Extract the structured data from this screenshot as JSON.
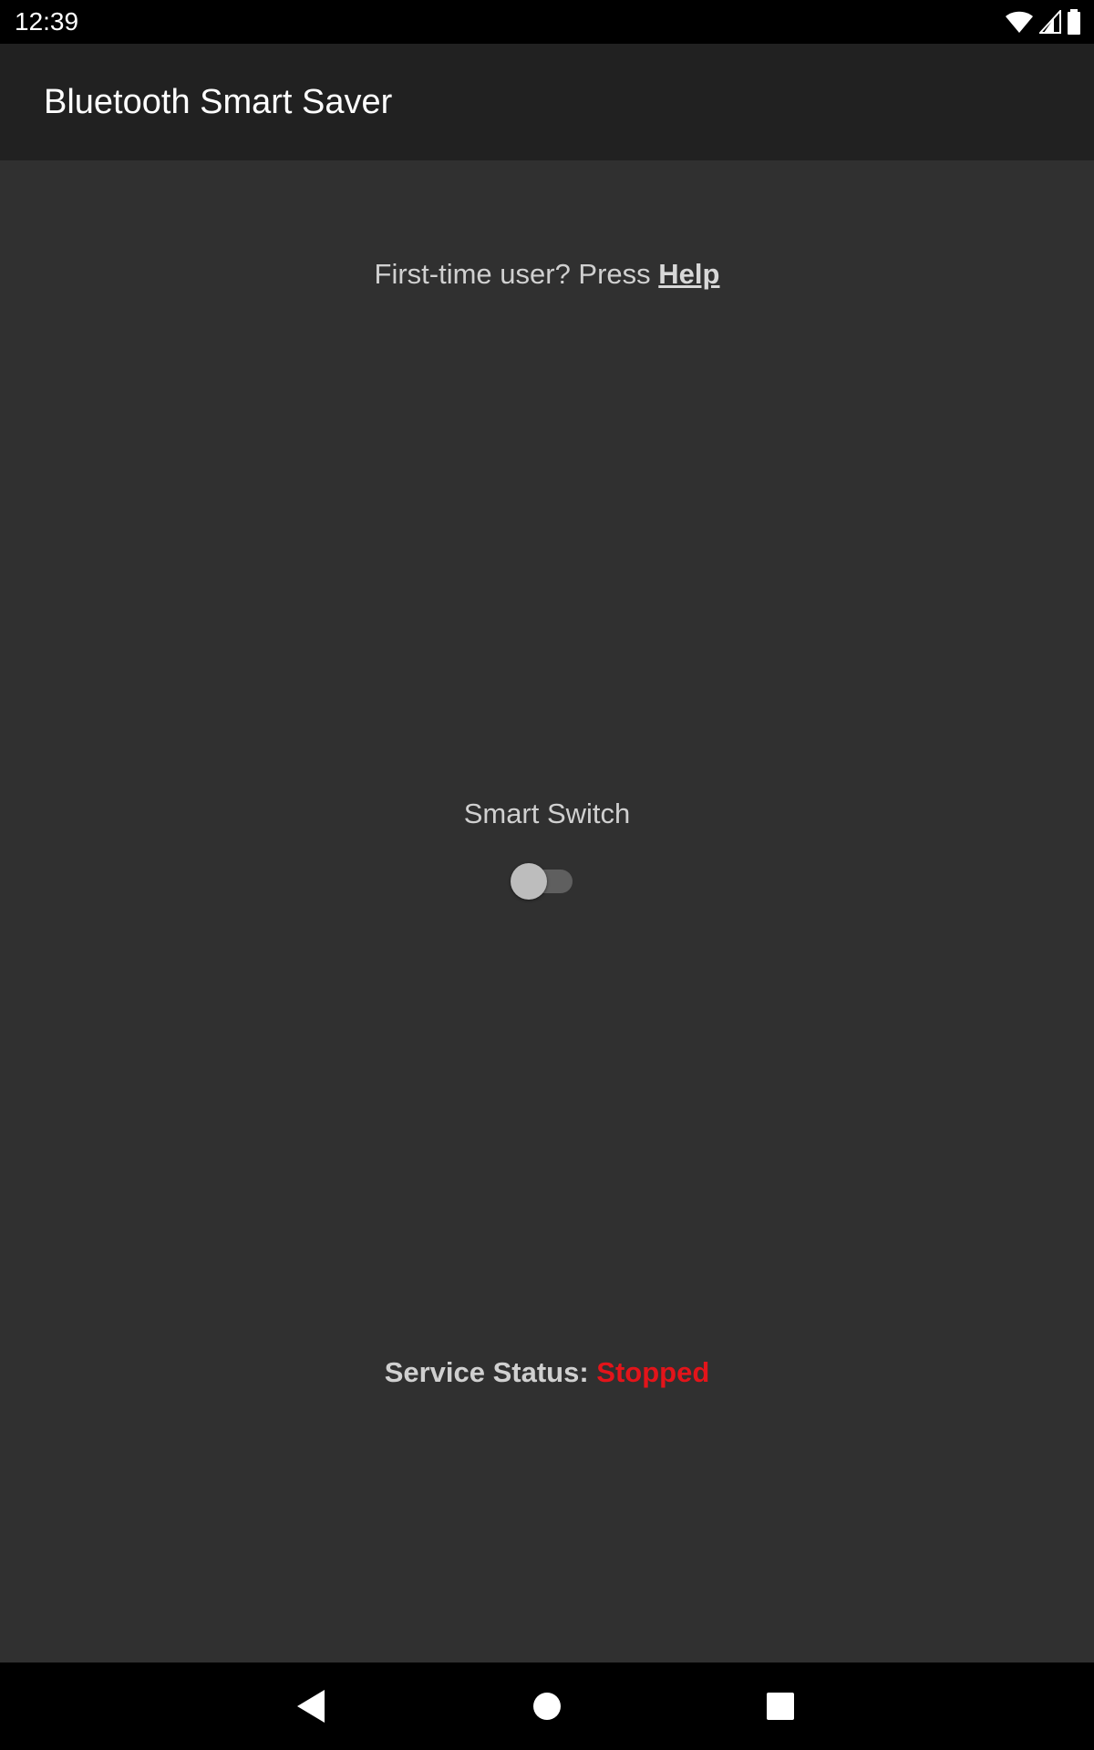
{
  "status_bar": {
    "time": "12:39",
    "icons": [
      "wifi-icon",
      "cell-signal-icon",
      "battery-icon"
    ]
  },
  "app_bar": {
    "title": "Bluetooth Smart Saver"
  },
  "main": {
    "intro_text": "First-time user? Press ",
    "help_link": "Help",
    "switch_label": "Smart Switch",
    "switch_on": false,
    "service_status_label": "Service Status: ",
    "service_status_value": "Stopped"
  },
  "nav_bar": {
    "buttons": [
      "back-icon",
      "home-icon",
      "recents-icon"
    ]
  },
  "colors": {
    "background": "#303030",
    "app_bar": "#212121",
    "status_stopped": "#e3141a"
  }
}
